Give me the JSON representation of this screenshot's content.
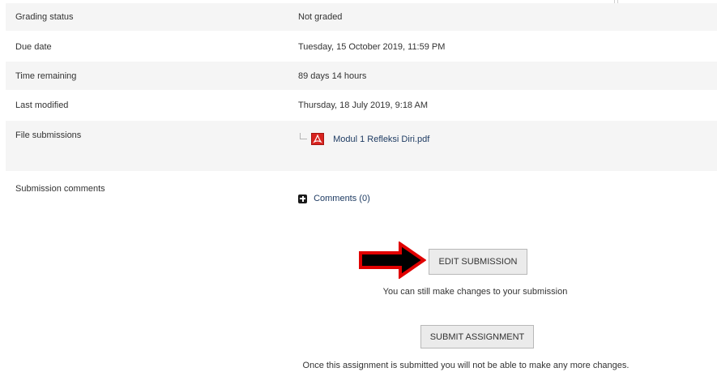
{
  "rows": [
    {
      "label": "Grading status",
      "value": "Not graded"
    },
    {
      "label": "Due date",
      "value": "Tuesday, 15 October 2019, 11:59 PM"
    },
    {
      "label": "Time remaining",
      "value": "89 days 14 hours"
    },
    {
      "label": "Last modified",
      "value": "Thursday, 18 July 2019, 9:18 AM"
    },
    {
      "label": "File submissions",
      "file": {
        "name": "Modul 1 Refleksi Diri.pdf",
        "icon": "pdf-icon"
      }
    },
    {
      "label": "Submission comments",
      "comments_link": "Comments (0)"
    }
  ],
  "actions": {
    "edit_label": "EDIT SUBMISSION",
    "edit_note": "You can still make changes to your submission",
    "submit_label": "SUBMIT ASSIGNMENT",
    "submit_note": "Once this assignment is submitted you will not be able to make any more changes."
  },
  "colors": {
    "row_stripe": "#f5f5f5",
    "link": "#1f3c63",
    "button_bg": "#ebebeb",
    "annotation_arrow_fill": "#000000",
    "annotation_arrow_outline": "#e00000",
    "pdf_red": "#d8231f"
  }
}
